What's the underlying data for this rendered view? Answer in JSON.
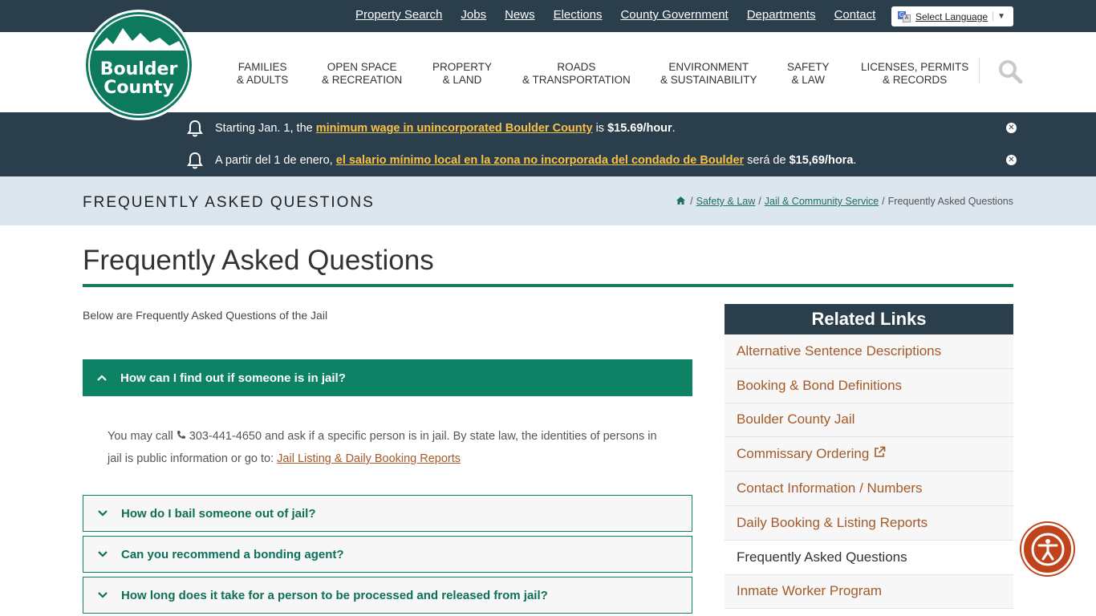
{
  "top_links": [
    "Property Search",
    "Jobs",
    "News",
    "Elections",
    "County Government",
    "Departments",
    "Contact"
  ],
  "translate": {
    "label": "Select Language",
    "caret": "▼"
  },
  "logo": {
    "line1": "Boulder",
    "line2": "County"
  },
  "nav": [
    {
      "l1": "FAMILIES",
      "l2": "& ADULTS"
    },
    {
      "l1": "OPEN SPACE",
      "l2": "& RECREATION"
    },
    {
      "l1": "PROPERTY",
      "l2": "& LAND"
    },
    {
      "l1": "ROADS",
      "l2": "& TRANSPORTATION"
    },
    {
      "l1": "ENVIRONMENT",
      "l2": "& SUSTAINABILITY"
    },
    {
      "l1": "SAFETY",
      "l2": "& LAW"
    },
    {
      "l1": "LICENSES, PERMITS",
      "l2": "& RECORDS"
    }
  ],
  "alerts": [
    {
      "pre": "Starting Jan. 1, the ",
      "link": "minimum wage in unincorporated Boulder County",
      "mid": " is ",
      "bold": "$15.69/hour",
      "post": "."
    },
    {
      "pre": "A partir del 1 de enero, ",
      "link": "el salario mínimo local en la zona no incorporada del condado de Boulder",
      "mid": " será de ",
      "bold": "$15,69/hora",
      "post": "."
    }
  ],
  "band": {
    "title": "FREQUENTLY ASKED QUESTIONS",
    "crumbs": [
      "Safety & Law",
      "Jail & Community Service"
    ],
    "current": "Frequently Asked Questions"
  },
  "page": {
    "title": "Frequently Asked Questions",
    "intro": "Below are Frequently Asked Questions of the Jail"
  },
  "faq": {
    "open_question": "How can I find out if someone is in jail?",
    "answer_pre": "You may call ",
    "phone": "303-441-4650",
    "answer_mid": " and ask if a specific person is in jail. By state law, the identities of persons in jail is public information or go to: ",
    "answer_link": "Jail Listing & Daily Booking Reports",
    "closed": [
      "How do I bail someone out of jail?",
      "Can you recommend a bonding agent?",
      "How long does it take for a person to be processed and released from jail?"
    ]
  },
  "related": {
    "title": "Related Links",
    "items": [
      "Alternative Sentence Descriptions",
      "Booking & Bond Definitions",
      "Boulder County Jail",
      "Commissary Ordering",
      "Contact Information / Numbers",
      "Daily Booking & Listing Reports",
      "Frequently Asked Questions",
      "Inmate Worker Program"
    ]
  },
  "colors": {
    "dark": "#2b3e4c",
    "green": "#0d8265",
    "link": "#a35a2a",
    "alert_link": "#f5c14a"
  }
}
